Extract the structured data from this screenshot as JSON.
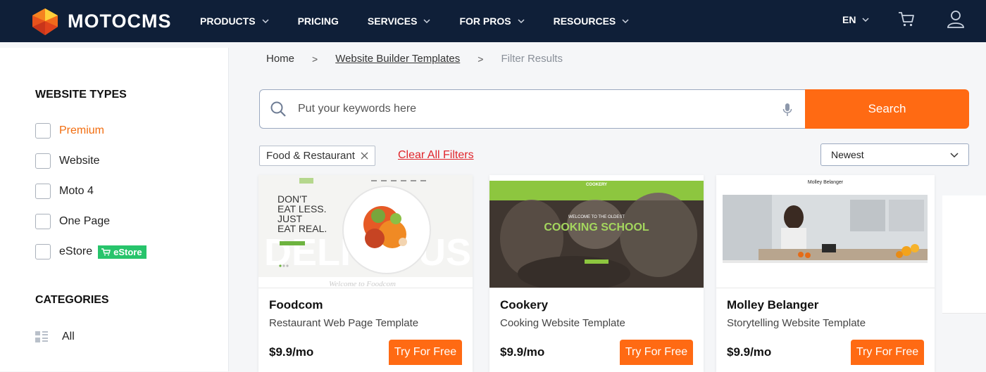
{
  "header": {
    "logo_text": "MOTOCMS",
    "nav": [
      {
        "label": "PRODUCTS",
        "has_dropdown": true
      },
      {
        "label": "PRICING",
        "has_dropdown": false
      },
      {
        "label": "SERVICES",
        "has_dropdown": true
      },
      {
        "label": "FOR PROS",
        "has_dropdown": true
      },
      {
        "label": "RESOURCES",
        "has_dropdown": true
      }
    ],
    "language": "EN",
    "icons": {
      "cart": "cart-icon",
      "user": "user-icon"
    }
  },
  "sidebar": {
    "types_heading": "WEBSITE TYPES",
    "types": [
      {
        "label": "Premium",
        "checked": false
      },
      {
        "label": "Website",
        "checked": false
      },
      {
        "label": "Moto 4",
        "checked": false
      },
      {
        "label": "One Page",
        "checked": false
      },
      {
        "label": "eStore",
        "checked": false,
        "badge": "eStore"
      }
    ],
    "categories_heading": "CATEGORIES",
    "categories": [
      {
        "label": "All"
      }
    ]
  },
  "breadcrumb": [
    "Home",
    "Website Builder Templates",
    "Filter Results"
  ],
  "search": {
    "placeholder": "Put your keywords here",
    "value": "",
    "button": "Search"
  },
  "filters": {
    "active": [
      "Food & Restaurant"
    ],
    "clear_label": "Clear All Filters",
    "sort_selected": "Newest"
  },
  "cards": [
    {
      "title": "Foodcom",
      "subtitle": "Restaurant Web Page Template",
      "price": "$9.9/mo",
      "cta": "Try For Free",
      "thumb": {
        "headline": "DON'T\nEAT LESS.\nJUST\nEAT REAL.",
        "bg_word": "DELICIOUS",
        "footer": "Welcome to Foodcom"
      }
    },
    {
      "title": "Cookery",
      "subtitle": "Cooking Website Template",
      "price": "$9.9/mo",
      "cta": "Try For Free",
      "thumb": {
        "small_text": "WELCOME TO THE OLDEST",
        "headline": "COOKING SCHOOL",
        "brand": "COOKERY"
      }
    },
    {
      "title": "Molley Belanger",
      "subtitle": "Storytelling Website Template",
      "price": "$9.9/mo",
      "cta": "Try For Free",
      "thumb": {
        "brand": "Molley Belanger"
      }
    }
  ],
  "colors": {
    "nav_bg": "#0f1f38",
    "accent": "#ff6a13",
    "clear_red": "#e0252b",
    "estore_green": "#27c46b"
  }
}
